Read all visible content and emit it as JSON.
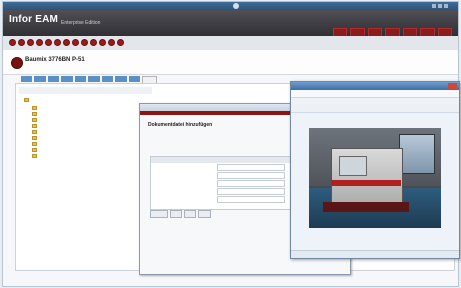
{
  "app": {
    "logo": "Infor EAM",
    "logo_sub": "Enterprise Edition"
  },
  "record": {
    "title": "Baumix 3776BN P-51",
    "description": "",
    "meta_line1": "",
    "meta_line2": ""
  },
  "doc_dialog": {
    "title": "",
    "heading": "Dokumentdatei hinzufügen",
    "subtitle": ""
  },
  "photo_window": {
    "title": "",
    "status_left": "",
    "status_right": ""
  },
  "colors": {
    "brand_red": "#8c1414",
    "header_dark": "#2f2f34",
    "tab_blue": "#5c8fc7"
  },
  "icons": {
    "os_logo": "windows-icon",
    "window_close": "close-icon"
  }
}
